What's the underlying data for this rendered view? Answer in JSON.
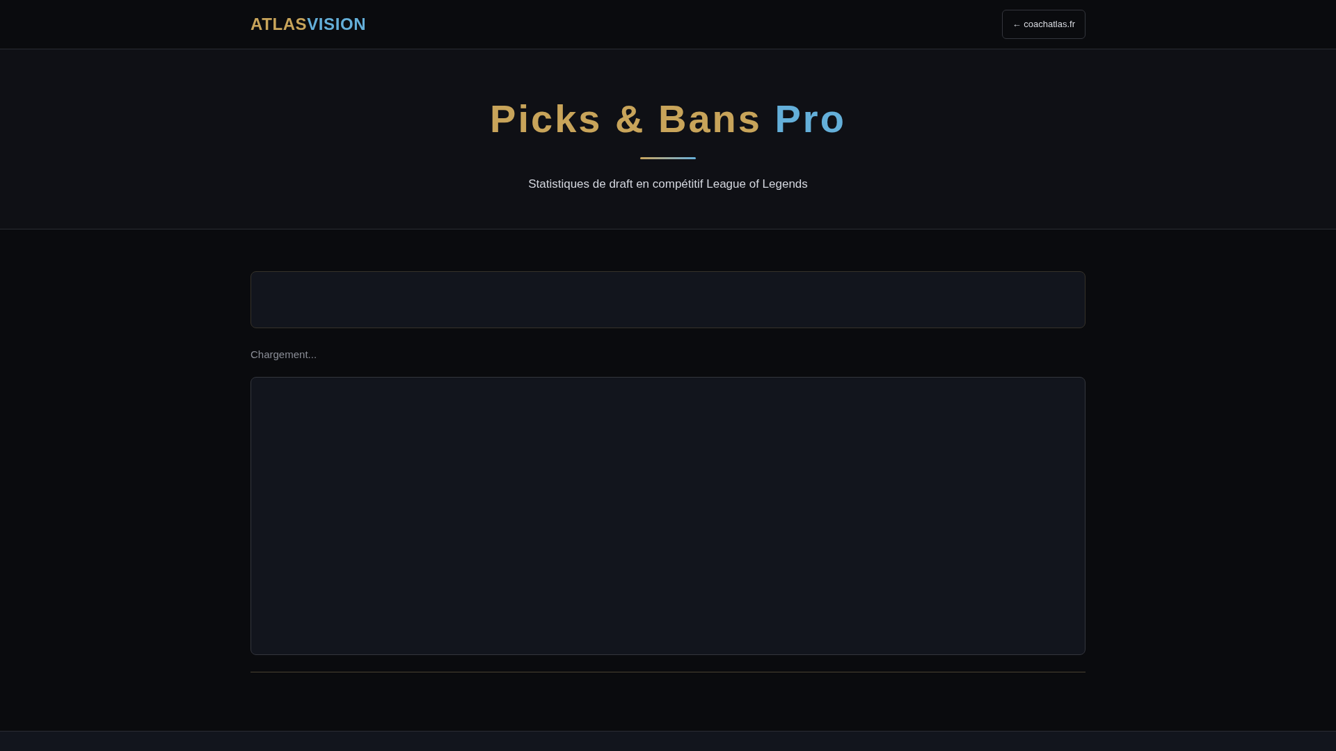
{
  "header": {
    "logo": {
      "primary": "ATLAS",
      "accent": "VISION"
    },
    "back_link": "← coachatlas.fr"
  },
  "hero": {
    "title": "Picks & Bans",
    "title_accent": "Pro",
    "subtitle": "Statistiques de draft en compétitif League of Legends"
  },
  "status": "Chargement..."
}
